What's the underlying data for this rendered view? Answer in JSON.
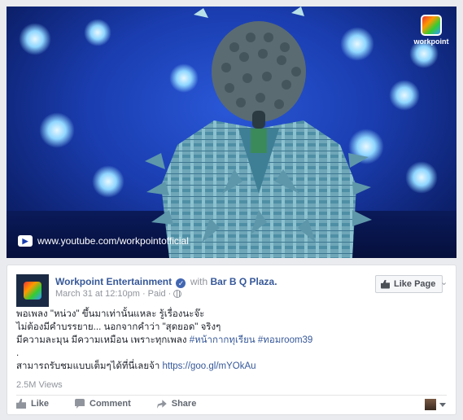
{
  "video": {
    "watermark_url": "www.youtube.com/workpointofficial",
    "watermark_logo": "workpoint",
    "icons": [
      "youtube-icon",
      "workpoint-logo"
    ]
  },
  "post": {
    "page_name": "Workpoint Entertainment",
    "with_text": "with",
    "place": "Bar B Q Plaza.",
    "timestamp": "March 31 at 12:10pm",
    "paid": "Paid",
    "like_page_label": "Like Page",
    "text_line1": "พอเพลง \"หน่วง\" ขึ้นมาเท่านั้นแหละ รู้เรื่องนะจ๊ะ",
    "text_line2": "ไม่ต้องมีคำบรรยาย... นอกจากคำว่า \"สุดยอด\" จริงๆ",
    "text_line3_pre": "มีความละมุน มีความเหมือน เพราะทุกเพลง",
    "hashtag1": "#หน้ากากทุเรียน",
    "hashtag2": "#ทอมroom39",
    "text_dot": ".",
    "text_line5_pre": "สามารถรับชมแบบเต็มๆได้ที่นี่เลยจ้า",
    "link": "https://goo.gl/mYOkAu",
    "views": "2.5M Views",
    "actions": {
      "like": "Like",
      "comment": "Comment",
      "share": "Share"
    },
    "colors": {
      "link": "#365899",
      "muted": "#90949c",
      "verified": "#4267b2"
    }
  }
}
